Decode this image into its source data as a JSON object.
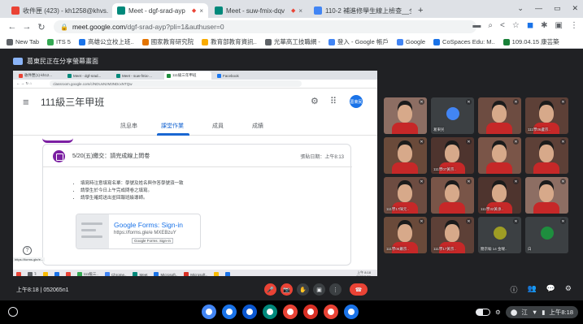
{
  "browser": {
    "tabs": [
      {
        "label": "收件匣 (423) - kh1258@khvs.",
        "color": "#ea4335",
        "active": false
      },
      {
        "label": "Meet - dgf-srad-ayp",
        "color": "#00897b",
        "active": true
      },
      {
        "label": "Meet - suw-fmix-dqv",
        "color": "#00897b",
        "active": false
      },
      {
        "label": "110-2 補進修學生線上檢查__全",
        "color": "#4285f4",
        "active": false
      }
    ],
    "tab_close": "×",
    "new_tab": "+",
    "window_controls": [
      "⌄",
      "—",
      "▭",
      "✕"
    ],
    "url_host": "meet.google.com",
    "url_path": "/dgf-srad-ayp?pli=1&authuser=0",
    "bookmarks": [
      {
        "label": "New Tab",
        "color": "#5f6368"
      },
      {
        "label": "ITS 5",
        "color": "#34a853"
      },
      {
        "label": "高雄公立校上班..",
        "color": "#1a73e8"
      },
      {
        "label": "國家教育研究院",
        "color": "#e37400"
      },
      {
        "label": "教育部教育資訊..",
        "color": "#f9ab00"
      },
      {
        "label": "光華高工技職網 -",
        "color": "#5f6368"
      },
      {
        "label": "登入 - Google 帳戶",
        "color": "#4285f4"
      },
      {
        "label": "Google",
        "color": "#4285f4"
      },
      {
        "label": "CoSpaces Edu: M..",
        "color": "#1a73e8"
      },
      {
        "label": "109.04.15 康芸築",
        "color": "#188038"
      }
    ]
  },
  "meet": {
    "presenting_banner": "葛東民正在分享螢幕畫面",
    "time": "上午8:18",
    "meeting_code": "052065n1",
    "controls": [
      "🎤",
      "📷",
      "✋",
      "▣",
      "⋮",
      "☎"
    ],
    "right_icons": [
      "ⓘ",
      "👥",
      "💬",
      "⚙"
    ]
  },
  "shared_screen": {
    "inner_tabs": [
      "收件匣(1)-kh12...",
      "Meet - dgf-srad...",
      "Meet - suw-fmix-...",
      "111級三年甲班",
      "Facebook"
    ],
    "inner_url": "classroom.google.com/c/NDUxNzM3NDcxNTQw",
    "class_title": "111級三年甲班",
    "nav_tabs": [
      {
        "label": "訊息串",
        "active": false
      },
      {
        "label": "課堂作業",
        "active": true
      },
      {
        "label": "成員",
        "active": false
      },
      {
        "label": "成績",
        "active": false
      }
    ],
    "avatar_label": "葛東民",
    "post_title": "5/20(五)繳交：請完成線上問卷",
    "post_date": "張貼日期：上午8:13",
    "post_items": [
      "填寫時注意填寫名單：學號及姓名與作答學號須一致",
      "請學生於今日上午完成問卷之填寫。",
      "請學生確認送出並回報班級導師。"
    ],
    "form_title": "Google Forms: Sign-in",
    "form_url": "https://forms.gle/e MXEBzuY",
    "form_tooltip": "Google Forms: Sign-in",
    "help": "?",
    "inner_status": "https://forms.gle/e...",
    "taskbar_items": [
      {
        "label": "",
        "color": "#ea4335"
      },
      {
        "label": "ꟻ",
        "color": "#5f6368"
      },
      {
        "label": "",
        "color": "#fbbc04"
      },
      {
        "label": "",
        "color": "#1a73e8"
      },
      {
        "label": "",
        "color": "#ea4335"
      },
      {
        "label": "111級三..",
        "color": "#34a853"
      },
      {
        "label": "Chrome..",
        "color": "#4285f4"
      },
      {
        "label": "Meet",
        "color": "#00897b"
      },
      {
        "label": "Microsoft..",
        "color": "#1a73e8"
      },
      {
        "label": "Microsoft..",
        "color": "#d93025"
      },
      {
        "label": "",
        "color": "#fbbc04"
      },
      {
        "label": "",
        "color": "#1a73e8"
      }
    ],
    "inner_clock_time": "上午 8:18",
    "inner_clock_date": "2022/5/20"
  },
  "participants": [
    {
      "name": "",
      "color": "#8d6e63",
      "face": true
    },
    {
      "name": "葛東民",
      "color": "#3c4043",
      "face": false,
      "avatar": "#4285f4"
    },
    {
      "name": "",
      "color": "#6d4c41",
      "face": true
    },
    {
      "name": "111學06盧宗..",
      "color": "#5d4037",
      "face": true
    },
    {
      "name": "",
      "color": "#6a4a3a",
      "face": true
    },
    {
      "name": "111學07黃宗..",
      "color": "#4e342e",
      "face": true
    },
    {
      "name": "",
      "color": "#7a5548",
      "face": true
    },
    {
      "name": "",
      "color": "#5d4037",
      "face": true
    },
    {
      "name": "111學17陳元..",
      "color": "#6d4c41",
      "face": true
    },
    {
      "name": "",
      "color": "#795548",
      "face": true
    },
    {
      "name": "111學32黃承..",
      "color": "#4e342e",
      "face": true
    },
    {
      "name": "",
      "color": "#8d6e63",
      "face": true
    },
    {
      "name": "111學06蕭宗..",
      "color": "#6a4a3a",
      "face": true
    },
    {
      "name": "111學17黃宗..",
      "color": "#5d4037",
      "face": true
    },
    {
      "name": "簡宗翰 14 金曜..",
      "color": "#3c4043",
      "face": false,
      "avatar": "#9e9d24"
    },
    {
      "name": "白",
      "color": "#3c4043",
      "face": false,
      "avatar": "#1e8e3e"
    }
  ],
  "shelf": {
    "apps": [
      {
        "color": "#4285f4"
      },
      {
        "color": "#1a73e8"
      },
      {
        "color": "#0b57d0"
      },
      {
        "color": "#00897b"
      },
      {
        "color": "#ea4335"
      },
      {
        "color": "#d93025"
      },
      {
        "color": "#ea4335"
      },
      {
        "color": "#1a73e8"
      }
    ],
    "tray_icons": [
      "⚙",
      "⬤"
    ],
    "tray": [
      "江",
      "▼",
      "▮"
    ],
    "clock": "上午8:18"
  }
}
